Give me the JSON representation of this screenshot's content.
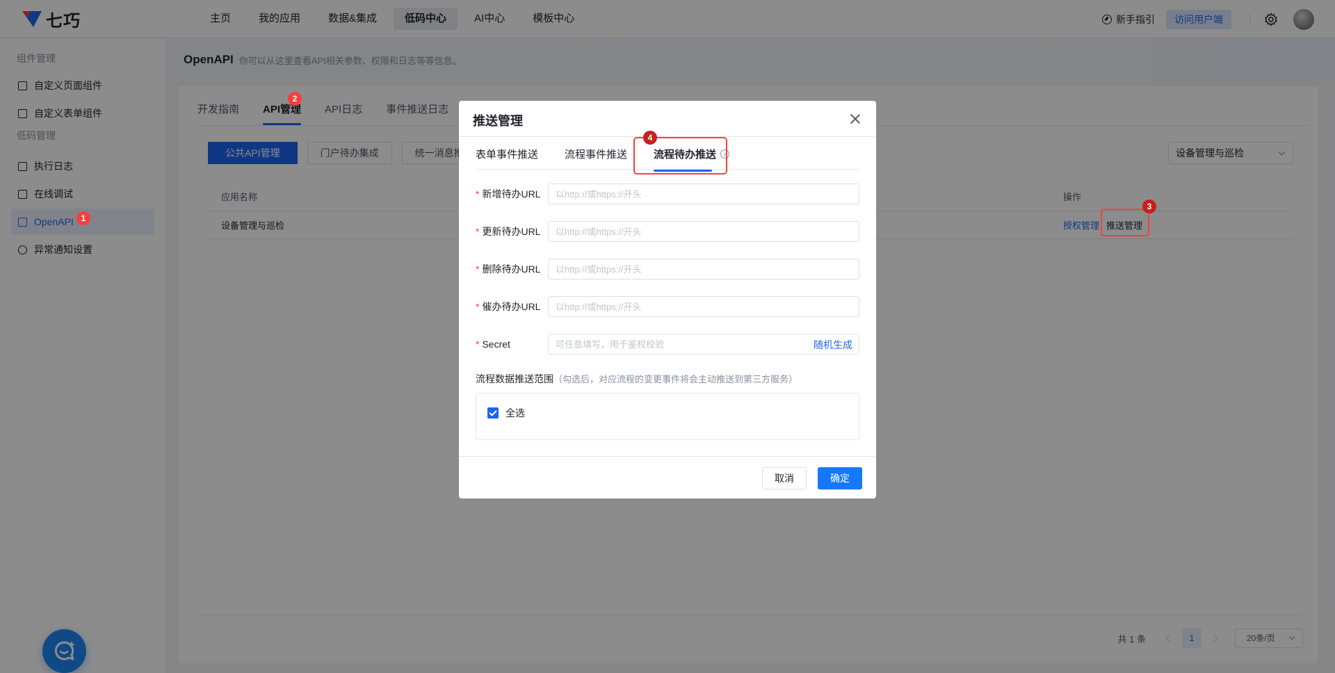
{
  "topbar": {
    "logo_text": "七巧",
    "nav": [
      "主页",
      "我的应用",
      "数据&集成",
      "低码中心",
      "AI中心",
      "模板中心"
    ],
    "active_nav": "低码中心",
    "guide": "新手指引",
    "visit": "访问用户端"
  },
  "sidebar": {
    "group1": "组件管理",
    "items1": [
      "自定义页面组件",
      "自定义表单组件"
    ],
    "group2": "低码管理",
    "items2": [
      "执行日志",
      "在线调试",
      "OpenAPI",
      "异常通知设置"
    ]
  },
  "main": {
    "title": "OpenAPI",
    "desc": "你可以从这里查看API相关参数、权限和日志等等信息。",
    "tabs": [
      "开发指南",
      "API管理",
      "API日志",
      "事件推送日志"
    ],
    "sub_buttons": [
      "公共API管理",
      "门户待办集成",
      "统一消息推"
    ],
    "app_select": "设备管理与巡检",
    "table": {
      "col_name": "应用名称",
      "col_op": "操作",
      "row_name": "设备管理与巡检",
      "op_auth": "授权管理",
      "op_push": "推送管理"
    },
    "pager": {
      "total": "共 1 条",
      "page": "1",
      "size": "20条/页"
    }
  },
  "dialog": {
    "title": "推送管理",
    "tabs": [
      "表单事件推送",
      "流程事件推送",
      "流程待办推送"
    ],
    "fields": [
      {
        "label": "新增待办URL",
        "placeholder": "以http://或https://开头"
      },
      {
        "label": "更新待办URL",
        "placeholder": "以http://或https://开头"
      },
      {
        "label": "删除待办URL",
        "placeholder": "以http://或https://开头"
      },
      {
        "label": "催办待办URL",
        "placeholder": "以http://或https://开头"
      },
      {
        "label": "Secret",
        "placeholder": "可任意填写，用于鉴权校验"
      }
    ],
    "generate": "随机生成",
    "scope_label": "流程数据推送范围",
    "scope_hint": "（勾选后，对应流程的变更事件将会主动推送到第三方服务）",
    "select_all": "全选",
    "cancel": "取消",
    "ok": "确定"
  },
  "annotations": [
    "1",
    "2",
    "3",
    "4"
  ],
  "colors": {
    "accent": "#1e64f0",
    "annotation": "#f53f3f"
  }
}
